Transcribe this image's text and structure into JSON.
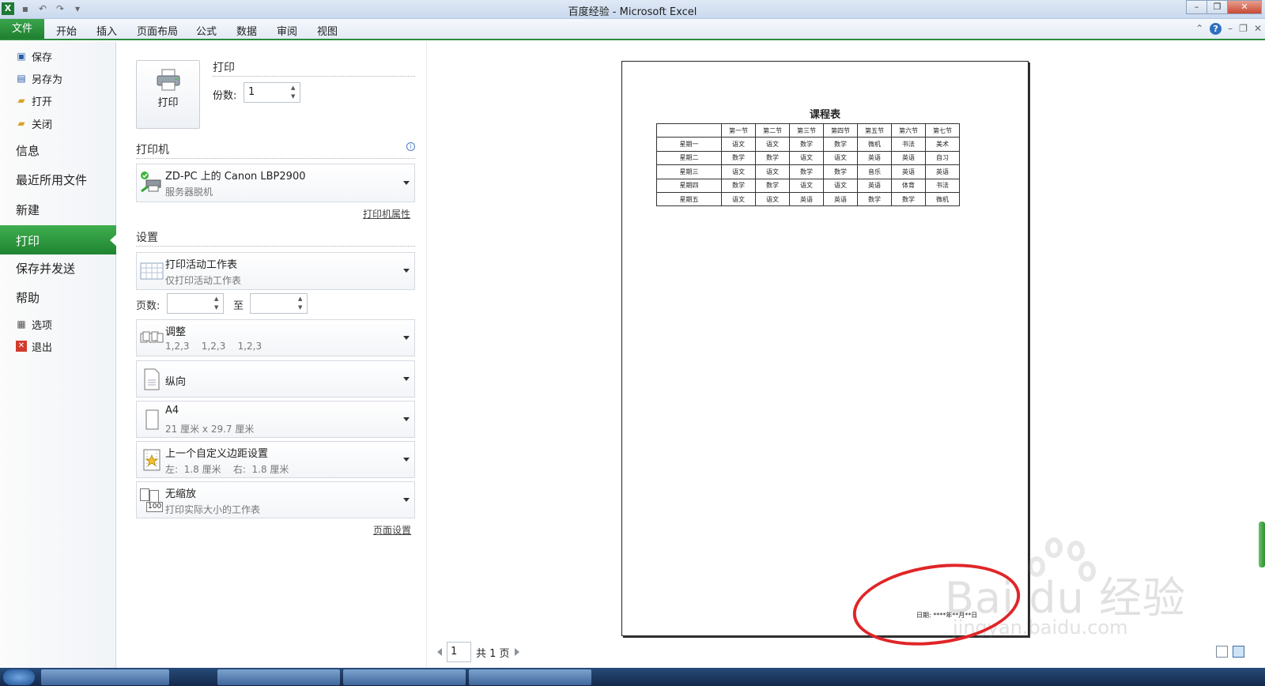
{
  "window": {
    "title": "百度经验 - Microsoft Excel",
    "app_icon": "X"
  },
  "ribbon": {
    "file_tab": "文件",
    "tabs": [
      "开始",
      "插入",
      "页面布局",
      "公式",
      "数据",
      "审阅",
      "视图"
    ]
  },
  "nav": {
    "save": "保存",
    "save_as": "另存为",
    "open": "打开",
    "close": "关闭",
    "info": "信息",
    "recent": "最近所用文件",
    "new": "新建",
    "print": "打印",
    "save_send": "保存并发送",
    "help": "帮助",
    "options": "选项",
    "exit": "退出"
  },
  "print_section": {
    "button_label": "打印",
    "title": "打印",
    "copies_label": "份数:",
    "copies_value": "1"
  },
  "printer_section": {
    "title": "打印机",
    "printer_name": "ZD-PC 上的 Canon LBP2900",
    "printer_status": "服务器脱机",
    "properties_link": "打印机属性"
  },
  "settings": {
    "title": "设置",
    "scope_main": "打印活动工作表",
    "scope_sub": "仅打印活动工作表",
    "pages_label": "页数:",
    "to_label": "至",
    "collate_main": "调整",
    "collate_sub": "1,2,3    1,2,3    1,2,3",
    "orientation": "纵向",
    "paper_main": "A4",
    "paper_sub": "21 厘米 x 29.7 厘米",
    "margins_main": "上一个自定义边距设置",
    "margins_sub": "左:  1.8 厘米    右:  1.8 厘米",
    "scaling_main": "无缩放",
    "scaling_sub": "打印实际大小的工作表",
    "scaling_icon_text": "100",
    "page_setup_link": "页面设置"
  },
  "preview": {
    "sheet_title": "课程表",
    "header_row": [
      "",
      "第一节",
      "第二节",
      "第三节",
      "第四节",
      "第五节",
      "第六节",
      "第七节"
    ],
    "rows": [
      [
        "星期一",
        "语文",
        "语文",
        "数学",
        "数学",
        "微机",
        "书法",
        "美术"
      ],
      [
        "星期二",
        "数学",
        "数学",
        "语文",
        "语文",
        "英语",
        "英语",
        "自习"
      ],
      [
        "星期三",
        "语文",
        "语文",
        "数学",
        "数学",
        "音乐",
        "英语",
        "英语"
      ],
      [
        "星期四",
        "数学",
        "数学",
        "语文",
        "语文",
        "英语",
        "体育",
        "书法"
      ],
      [
        "星期五",
        "语文",
        "语文",
        "英语",
        "英语",
        "数学",
        "数学",
        "微机"
      ]
    ],
    "footer_date": "日期:  ****年**月**日",
    "page_current": "1",
    "page_total": "共 1 页"
  },
  "watermark": {
    "main": "Bai du 经验",
    "url": "jingyan.baidu.com"
  },
  "colors": {
    "accent_green": "#2b8d3e",
    "highlight_red": "#e02528"
  }
}
